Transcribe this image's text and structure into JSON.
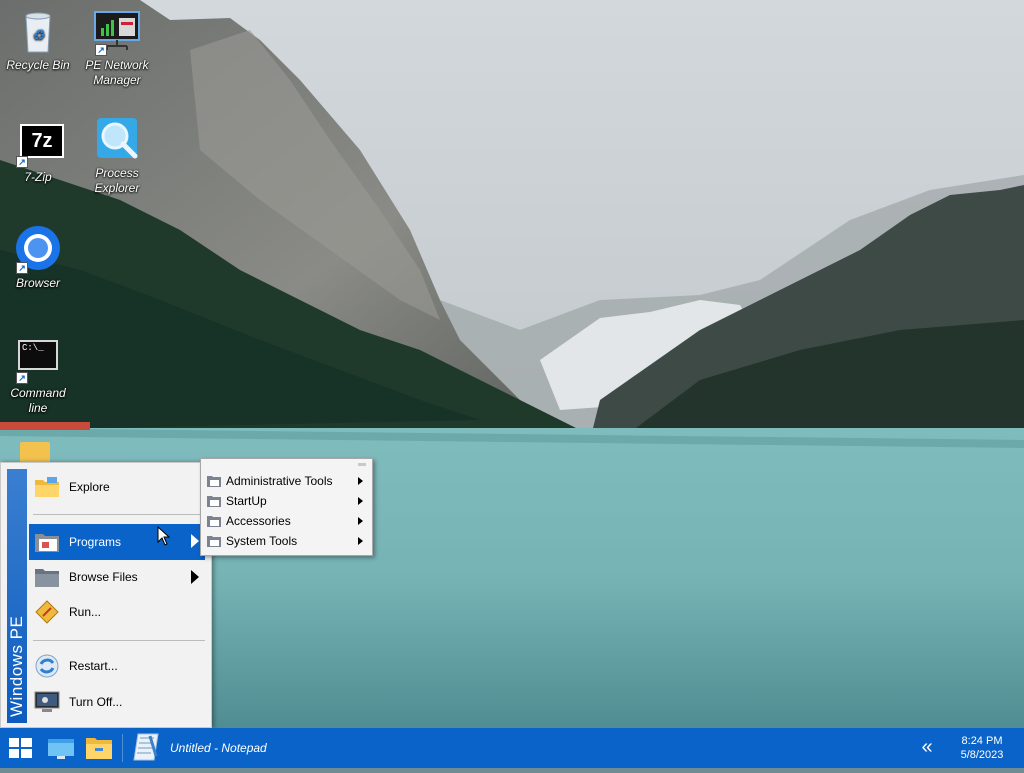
{
  "desktop": {
    "icons": [
      {
        "label": "Recycle Bin",
        "icon": "recycle-bin-icon"
      },
      {
        "label": "PE Network Manager",
        "icon": "network-manager-icon"
      },
      {
        "label": "7-Zip",
        "icon": "7zip-icon"
      },
      {
        "label": "Process Explorer",
        "icon": "process-explorer-icon"
      },
      {
        "label": "Browser",
        "icon": "browser-icon"
      },
      {
        "label": "Command line",
        "icon": "command-line-icon"
      }
    ],
    "shortcut_glyph": "↗",
    "sevenzip_glyph": "7z",
    "cmd_glyph": "C:\\_"
  },
  "start_menu": {
    "banner": "Windows PE",
    "items": [
      {
        "label": "Explore"
      },
      {
        "label": "Programs"
      },
      {
        "label": "Browse Files"
      },
      {
        "label": "Run..."
      },
      {
        "label": "Restart..."
      },
      {
        "label": "Turn Off..."
      }
    ]
  },
  "programs_submenu": {
    "items": [
      {
        "label": "Administrative Tools"
      },
      {
        "label": "StartUp"
      },
      {
        "label": "Accessories"
      },
      {
        "label": "System Tools"
      }
    ]
  },
  "taskbar": {
    "task_title": "Untitled - Notepad",
    "clock_time": "8:24 PM",
    "clock_date": "5/8/2023",
    "tray_glyph": "«"
  },
  "colors": {
    "taskbar": "#0a63c8",
    "menu_highlight": "#0a63c8",
    "menu_background": "#f2f2f2"
  }
}
